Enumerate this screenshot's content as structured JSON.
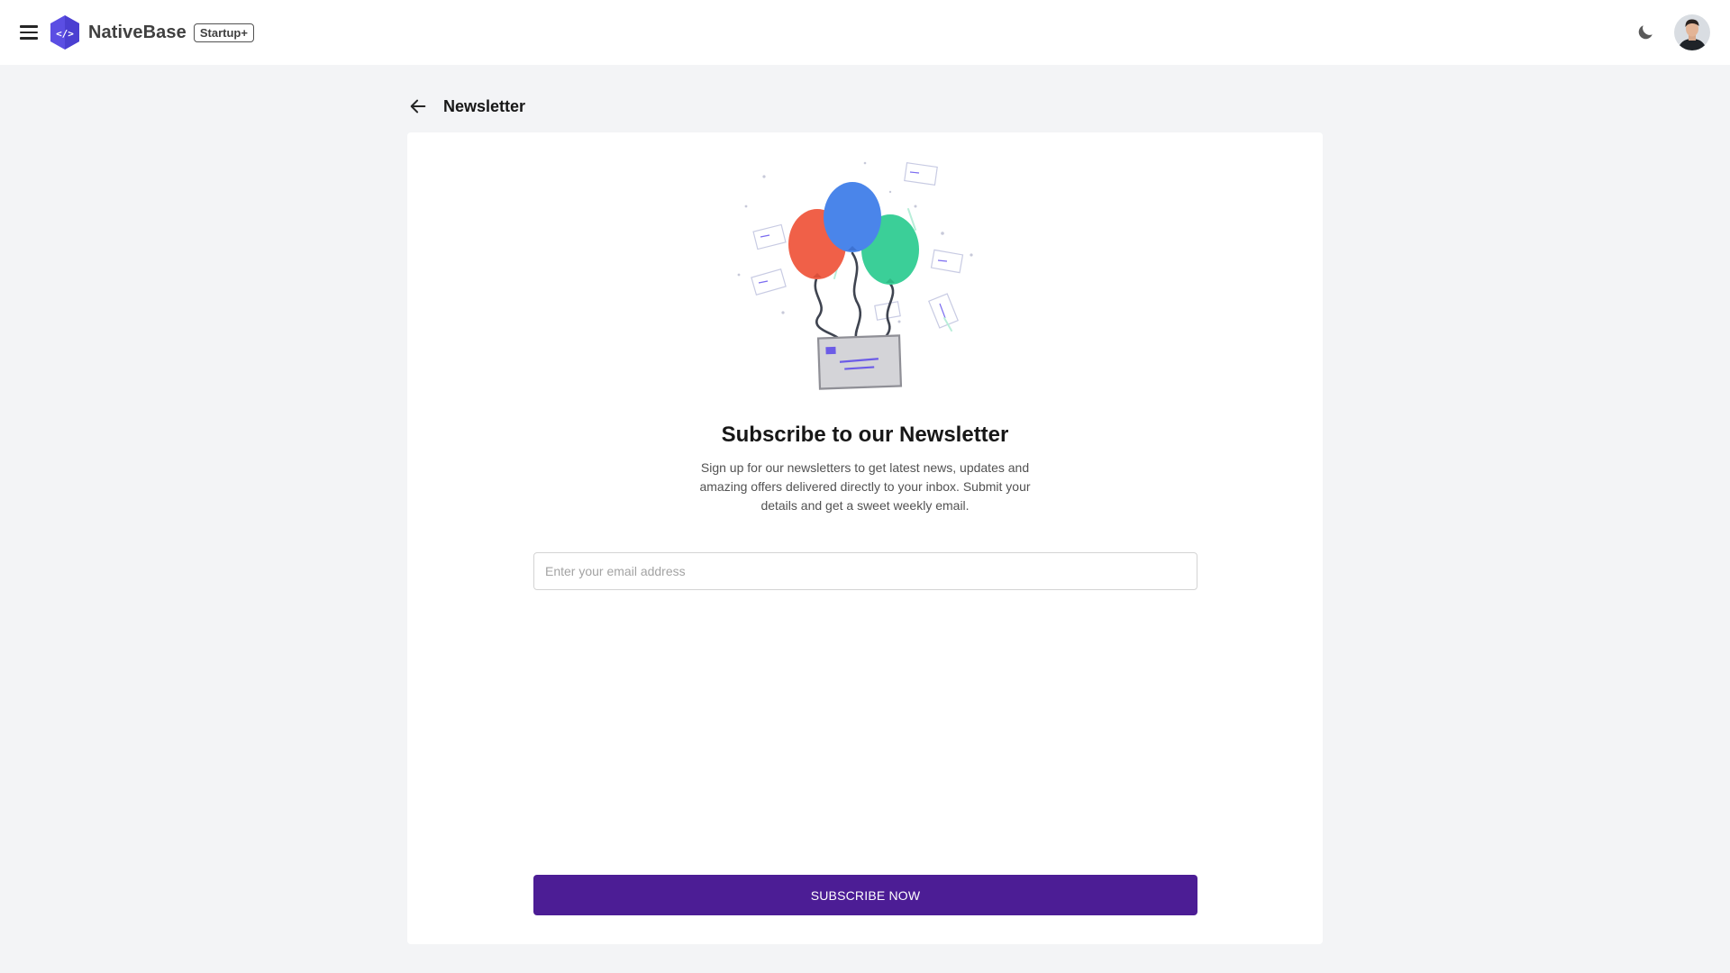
{
  "app": {
    "brand_name": "NativeBase",
    "plan_badge": "Startup+"
  },
  "icons": {
    "menu": "hamburger-menu-icon",
    "logo": "nativebase-logo-icon",
    "theme": "moon-icon",
    "back": "arrow-left-icon"
  },
  "header": {
    "title": "Newsletter"
  },
  "main": {
    "heading": "Subscribe to our Newsletter",
    "description": "Sign up for our newsletters to get latest news, updates and amazing offers delivered directly to your inbox. Submit your details and get a sweet weekly email.",
    "email_placeholder": "Enter your email address",
    "email_value": "",
    "subscribe_label": "SUBSCRIBE NOW"
  },
  "colors": {
    "accent": "#4c1d95",
    "logo": "#5b4ee3",
    "balloon_red": "#f06048",
    "balloon_blue": "#4a85ea",
    "balloon_green": "#3bcf98"
  }
}
